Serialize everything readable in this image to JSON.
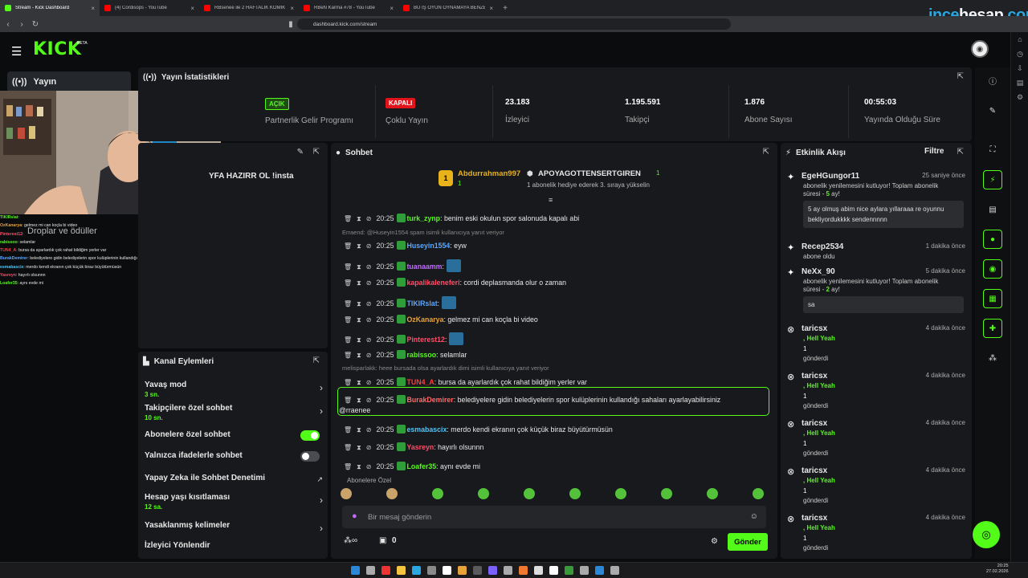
{
  "browser": {
    "tabs": [
      {
        "title": "Stream - Kick Dashboard",
        "active": true,
        "color": "#53fc18"
      },
      {
        "title": "(4) Cordisops - YouTube",
        "color": "#ff0000"
      },
      {
        "title": "RBsenee ile 2 HAFTALIK KOMİK ANI...",
        "color": "#ff0000"
      },
      {
        "title": "RBeN Karma #78 - YouTube",
        "color": "#ff0000"
      },
      {
        "title": "BU İŞ OYUN OYNAMAYA BENZEMİ...",
        "color": "#ff0000"
      }
    ],
    "url": "dashboard.kick.com/stream"
  },
  "watermark": {
    "a": "ince",
    "b": "hesap",
    "c": ".com"
  },
  "brand": {
    "logo": "KICK",
    "beta": "BETA"
  },
  "nav": {
    "active": "Yayın",
    "drops": "Droplar ve ödüller"
  },
  "cam_chat": [
    {
      "user": "TIKIRslat",
      "text": ":",
      "color": "#53fc18"
    },
    {
      "user": "OzKanarya",
      "text": ": gelmez mi can koçla bi video",
      "color": "#e8a23a"
    },
    {
      "user": "Pinterest12",
      "text": ":",
      "color": "#ff4d6a"
    },
    {
      "user": "rabissoo",
      "text": ": selamlar",
      "color": "#53fc18"
    },
    {
      "user": "TUN4_A",
      "text": ": bursa da ayarlardık çok rahat bildiğim yerler var",
      "color": "#ff3b3b"
    },
    {
      "user": "BurakDemirer",
      "text": ": belediyelere gidin belediyelerin spor kulüplerinin kullandığı sahaları ayarlayabilirsiniz @rraenee",
      "color": "#5aa7ff"
    },
    {
      "user": "esmabascix",
      "text": ": merdo kendi ekranın çok küçük biraz büyütürmüsün",
      "color": "#4fc3f7"
    },
    {
      "user": "Yasreyn",
      "text": ": hayırlı olsunnn",
      "color": "#ff4d6a"
    },
    {
      "user": "Loafer35",
      "text": ": aynı evde mi",
      "color": "#53fc18"
    }
  ],
  "stats": {
    "title": "Yayın İstatistikleri",
    "partner_badge": "AÇIK",
    "partner_label": "Partnerlik Gelir Programı",
    "multi_badge": "KAPALI",
    "multi_label": "Çoklu Yayın",
    "viewers": "23.183",
    "viewers_label": "İzleyici",
    "followers": "1.195.591",
    "followers_label": "Takipçi",
    "subs": "1.876",
    "subs_label": "Abone Sayısı",
    "uptime": "00:55:03",
    "uptime_label": "Yayında Olduğu Süre"
  },
  "stream_title": "YFA HAZIRR OL !insta",
  "actions": {
    "title": "Kanal Eylemleri",
    "slow": "Yavaş mod",
    "slow_sub": "3 sn.",
    "followers_only": "Takipçilere özel sohbet",
    "followers_only_sub": "10 sn.",
    "subs_only": "Abonelere özel sohbet",
    "emote_only": "Yalnızca ifadelerle sohbet",
    "ai_mod": "Yapay Zeka ile Sohbet Denetimi",
    "age": "Hesap yaşı kısıtlaması",
    "age_sub": "12 sa.",
    "banned": "Yasaklanmış kelimeler",
    "redirect": "İzleyici Yönlendir"
  },
  "chat": {
    "title": "Sohbet",
    "pinned_user1": "Abdurrahman997",
    "pinned_count1": "1",
    "pinned_rank": "1",
    "pinned_user2": "APOYAGOTTENSERTGIREN",
    "pinned_count2": "1",
    "pinned_note": "1 abonelik hediye ederek 3. sıraya yükselin",
    "messages": [
      {
        "time": "20:25",
        "user": "turk_zynp",
        "color": "#53fc18",
        "text": ": benim eski okulun spor salonuda kapalı abi"
      },
      {
        "reply": "Erraend: @Huseyin1554 spam isimli kullanıcıya yanıt veriyor"
      },
      {
        "time": "20:25",
        "user": "Huseyin1554",
        "color": "#5aa7ff",
        "text": ": eyw"
      },
      {
        "time": "20:25",
        "user": "tuanaamm",
        "color": "#c26bff",
        "text": ":",
        "emote": true
      },
      {
        "time": "20:25",
        "user": "kapalikaleneferi",
        "color": "#ff4d6a",
        "text": ": cordi deplasmanda olur o zaman"
      },
      {
        "time": "20:25",
        "user": "TIKIRslat",
        "color": "#5aa7ff",
        "text": ":",
        "emote": true
      },
      {
        "time": "20:25",
        "user": "OzKanarya",
        "color": "#e8a23a",
        "text": ": gelmez mi can koçla bi video"
      },
      {
        "time": "20:25",
        "user": "Pinterest12",
        "color": "#ff4d6a",
        "text": ":",
        "emote": true
      },
      {
        "time": "20:25",
        "user": "rabissoo",
        "color": "#53fc18",
        "text": ": selamlar"
      },
      {
        "reply": "melisparlakk: heee bursada olsa ayarlardık dimi isimli kullanıcıya yanıt veriyor"
      },
      {
        "time": "20:25",
        "user": "TUN4_A",
        "color": "#ff3b3b",
        "text": ": bursa da ayarlardık çok rahat bildiğim yerler var"
      },
      {
        "time": "20:25",
        "user": "BurakDemirer",
        "color": "#ff6a6a",
        "text": ": belediyelere gidin belediyelerin spor kulüplerinin kullandığı sahaları ayarlayabilirsiniz",
        "cont": "@rraenee"
      },
      {
        "time": "20:25",
        "user": "esmabascix",
        "color": "#4fc3f7",
        "text": ": merdo kendi ekranın çok küçük biraz büyütürmüsün"
      },
      {
        "time": "20:25",
        "user": "Yasreyn",
        "color": "#ff4d6a",
        "text": ": hayırlı olsunnn"
      },
      {
        "time": "20:25",
        "user": "Loafer35",
        "color": "#53fc18",
        "text": ": aynı evde mi"
      }
    ],
    "emote_label": "Abonelere Özel",
    "placeholder": "Bir mesaj gönderin",
    "kicks": "0",
    "send": "Gönder"
  },
  "activity": {
    "title": "Etkinlik Akışı",
    "filter": "Filtre",
    "events": [
      {
        "user": "EgeHGungor11",
        "time": "25 saniye önce",
        "line1": "abonelik yenilemesini kutluyor! Toplam abonelik",
        "line2a": "süresi - ",
        "line2b": "5",
        "line2c": " ay!",
        "quote1": "5 ay olmuş abim nice aylara yıllaraaa re oyunnu",
        "quote2": "bekliyordukkkk sendennnnn"
      },
      {
        "user": "Recep2534",
        "time": "1 dakika önce",
        "line1": "abone oldu"
      },
      {
        "user": "NeXx_90",
        "time": "5 dakika önce",
        "line1": "abonelik yenilemesini kutluyor! Toplam abonelik",
        "line2a": "süresi - ",
        "line2b": "2",
        "line2c": " ay!",
        "quote1": "sa"
      },
      {
        "user": "taricsx",
        "time": "4 dakika önce",
        "gift": ", Hell Yeah",
        "amount": "1",
        "sent": "gönderdi"
      },
      {
        "user": "taricsx",
        "time": "4 dakika önce",
        "gift": ", Hell Yeah",
        "amount": "1",
        "sent": "gönderdi"
      },
      {
        "user": "taricsx",
        "time": "4 dakika önce",
        "gift": ", Hell Yeah",
        "amount": "1",
        "sent": "gönderdi"
      },
      {
        "user": "taricsx",
        "time": "4 dakika önce",
        "gift": ", Hell Yeah",
        "amount": "1",
        "sent": "gönderdi"
      },
      {
        "user": "taricsx",
        "time": "4 dakika önce",
        "gift": ", Hell Yeah",
        "amount": "1",
        "sent": "gönderdi"
      }
    ]
  },
  "clock": {
    "time": "20:25",
    "date": "27.02.2026"
  },
  "colors": {
    "accent": "#53fc18",
    "panel": "#18191c",
    "bg": "#0b0c0e"
  }
}
